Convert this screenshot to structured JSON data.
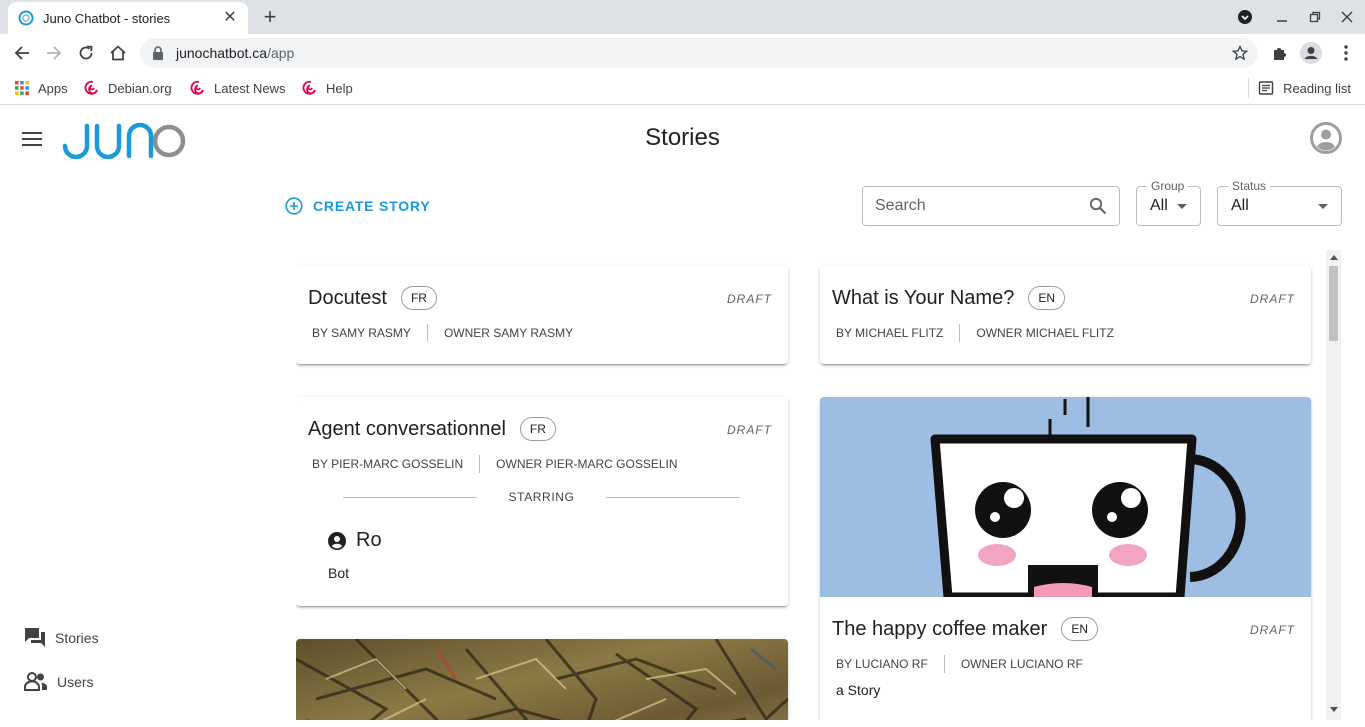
{
  "browser": {
    "tab_title": "Juno Chatbot - stories",
    "url_host": "junochatbot.ca",
    "url_path": "/app",
    "bookmarks": [
      {
        "label": "Apps",
        "icon": "apps-grid-icon"
      },
      {
        "label": "Debian.org",
        "icon": "debian-icon"
      },
      {
        "label": "Latest News",
        "icon": "debian-icon"
      },
      {
        "label": "Help",
        "icon": "debian-icon"
      }
    ],
    "reading_list": "Reading list"
  },
  "app": {
    "logo_text": "JUNO",
    "page_title": "Stories",
    "accent_color": "#1a9ad9"
  },
  "sidebar": {
    "items": [
      {
        "label": "Stories",
        "icon": "forum-icon"
      },
      {
        "label": "Users",
        "icon": "people-icon"
      }
    ]
  },
  "toolbar": {
    "create_label": "CREATE STORY",
    "search_placeholder": "Search",
    "group_label": "Group",
    "group_value": "All",
    "status_label": "Status",
    "status_value": "All"
  },
  "stories": [
    {
      "title": "Docutest",
      "lang": "FR",
      "status": "DRAFT",
      "by": "BY SAMY RASMY",
      "owner": "OWNER SAMY RASMY"
    },
    {
      "title": "What is Your Name?",
      "lang": "EN",
      "status": "DRAFT",
      "by": "BY MICHAEL FLITZ",
      "owner": "OWNER MICHAEL FLITZ"
    },
    {
      "title": "Agent conversationnel",
      "lang": "FR",
      "status": "DRAFT",
      "by": "BY PIER-MARC GOSSELIN",
      "owner": "OWNER PIER-MARC GOSSELIN",
      "starring_label": "STARRING",
      "actor_name": "Ro",
      "actor_role": "Bot"
    },
    {
      "title": "The happy coffee maker",
      "lang": "EN",
      "status": "DRAFT",
      "by": "BY LUCIANO RF",
      "owner": "OWNER LUCIANO RF",
      "synopsis": "a Story",
      "image": "coffee-cup-illustration"
    },
    {
      "image": "abstract-painting"
    }
  ]
}
